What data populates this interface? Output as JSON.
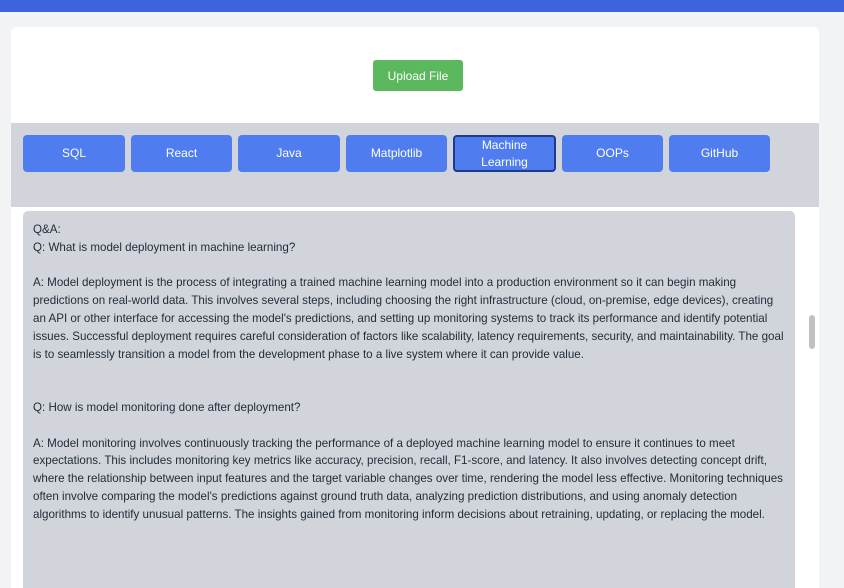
{
  "upload": {
    "label": "Upload File"
  },
  "tabs": [
    {
      "label": "SQL"
    },
    {
      "label": "React"
    },
    {
      "label": "Java"
    },
    {
      "label": "Matplotlib"
    },
    {
      "label": "Machine Learning"
    },
    {
      "label": "OOPs"
    },
    {
      "label": "GitHub"
    }
  ],
  "active_tab": "Machine Learning",
  "qa": {
    "heading": "Q&A:",
    "items": [
      {
        "question": "Q: What is model deployment in machine learning?",
        "answer": "A: Model deployment is the process of integrating a trained machine learning model into a production environment so it can begin making predictions on real-world data. This involves several steps, including choosing the right infrastructure (cloud, on-premise, edge devices), creating an API or other interface for accessing the model's predictions, and setting up monitoring systems to track its performance and identify potential issues. Successful deployment requires careful consideration of factors like scalability, latency requirements, security, and maintainability. The goal is to seamlessly transition a model from the development phase to a live system where it can provide value."
      },
      {
        "question": "Q: How is model monitoring done after deployment?",
        "answer": "A: Model monitoring involves continuously tracking the performance of a deployed machine learning model to ensure it continues to meet expectations. This includes monitoring key metrics like accuracy, precision, recall, F1-score, and latency. It also involves detecting concept drift, where the relationship between input features and the target variable changes over time, rendering the model less effective. Monitoring techniques often involve comparing the model's predictions against ground truth data, analyzing prediction distributions, and using anomaly detection algorithms to identify unusual patterns. The insights gained from monitoring inform decisions about retraining, updating, or replacing the model."
      }
    ]
  },
  "colors": {
    "topbar": "#3d63dd",
    "upload_button": "#5cb85c",
    "tab_button": "#4f7df0",
    "tabs_bar": "#d1d5db",
    "qa_background": "#d1d5db"
  }
}
